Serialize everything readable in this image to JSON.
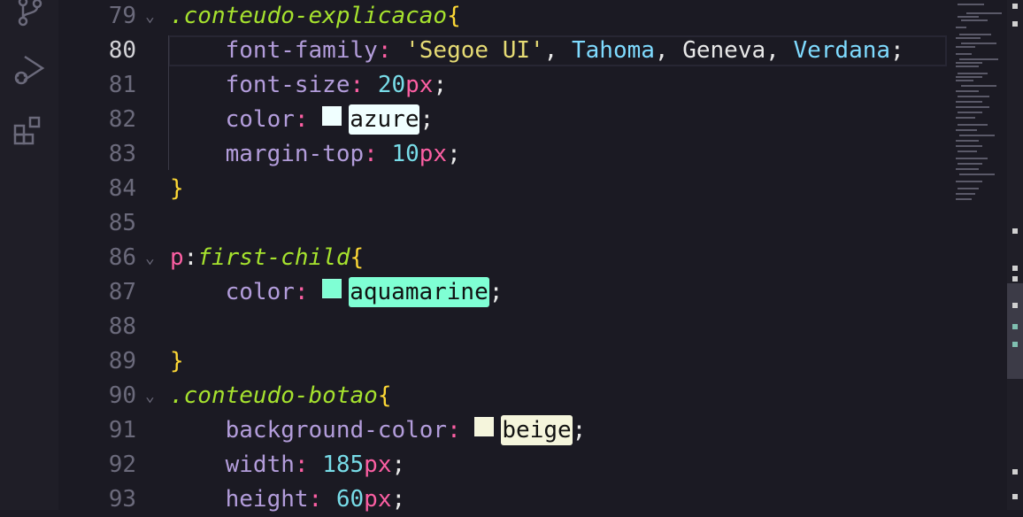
{
  "activity_bar": {
    "icons": [
      "source-control-icon",
      "run-debug-icon",
      "extensions-icon"
    ]
  },
  "editor": {
    "lines": [
      {
        "num": "79",
        "fold": "⌄",
        "tokens": [
          {
            "t": ".conteudo-explicacao",
            "c": "sel"
          },
          {
            "t": "{",
            "c": "brace"
          }
        ]
      },
      {
        "num": "80",
        "active": true,
        "tokens": [
          {
            "t": "    font-family",
            "c": "prop"
          },
          {
            "t": ": ",
            "c": "punc"
          },
          {
            "t": "'Segoe UI'",
            "c": "str"
          },
          {
            "t": ", ",
            "c": "plain"
          },
          {
            "t": "Tahoma",
            "c": "font"
          },
          {
            "t": ", ",
            "c": "plain"
          },
          {
            "t": "Geneva",
            "c": "plain"
          },
          {
            "t": ", ",
            "c": "plain"
          },
          {
            "t": "Verdana",
            "c": "font"
          },
          {
            "t": ";",
            "c": "plain"
          }
        ]
      },
      {
        "num": "81",
        "tokens": [
          {
            "t": "    font-size",
            "c": "prop"
          },
          {
            "t": ": ",
            "c": "punc"
          },
          {
            "t": "20",
            "c": "num"
          },
          {
            "t": "px",
            "c": "unit"
          },
          {
            "t": ";",
            "c": "plain"
          }
        ]
      },
      {
        "num": "82",
        "tokens": [
          {
            "t": "    color",
            "c": "prop"
          },
          {
            "t": ": ",
            "c": "punc"
          },
          {
            "swatch": "#f0ffff",
            "word": "azure"
          },
          {
            "t": ";",
            "c": "plain"
          }
        ]
      },
      {
        "num": "83",
        "tokens": [
          {
            "t": "    margin-top",
            "c": "prop"
          },
          {
            "t": ": ",
            "c": "punc"
          },
          {
            "t": "10",
            "c": "num"
          },
          {
            "t": "px",
            "c": "unit"
          },
          {
            "t": ";",
            "c": "plain"
          }
        ]
      },
      {
        "num": "84",
        "tokens": [
          {
            "t": "}",
            "c": "brace"
          }
        ]
      },
      {
        "num": "85",
        "tokens": []
      },
      {
        "num": "86",
        "fold": "⌄",
        "tokens": [
          {
            "t": "p",
            "c": "tag"
          },
          {
            "t": ":",
            "c": "plain"
          },
          {
            "t": "first-child",
            "c": "pseudo"
          },
          {
            "t": "{",
            "c": "brace"
          }
        ]
      },
      {
        "num": "87",
        "tokens": [
          {
            "t": "    color",
            "c": "prop"
          },
          {
            "t": ": ",
            "c": "punc"
          },
          {
            "swatch": "#7fffd4",
            "word": "aquamarine"
          },
          {
            "t": ";",
            "c": "plain"
          }
        ]
      },
      {
        "num": "88",
        "tokens": []
      },
      {
        "num": "89",
        "tokens": [
          {
            "t": "}",
            "c": "brace"
          }
        ]
      },
      {
        "num": "90",
        "fold": "⌄",
        "tokens": [
          {
            "t": ".conteudo-botao",
            "c": "sel"
          },
          {
            "t": "{",
            "c": "brace"
          }
        ]
      },
      {
        "num": "91",
        "tokens": [
          {
            "t": "    background-color",
            "c": "prop"
          },
          {
            "t": ": ",
            "c": "punc"
          },
          {
            "swatch": "#f5f5dc",
            "word": "beige"
          },
          {
            "t": ";",
            "c": "plain"
          }
        ]
      },
      {
        "num": "92",
        "tokens": [
          {
            "t": "    width",
            "c": "prop"
          },
          {
            "t": ": ",
            "c": "punc"
          },
          {
            "t": "185",
            "c": "num"
          },
          {
            "t": "px",
            "c": "unit"
          },
          {
            "t": ";",
            "c": "plain"
          }
        ]
      },
      {
        "num": "93",
        "tokens": [
          {
            "t": "    height",
            "c": "prop"
          },
          {
            "t": ": ",
            "c": "punc"
          },
          {
            "t": "60",
            "c": "num"
          },
          {
            "t": "px",
            "c": "unit"
          },
          {
            "t": ";",
            "c": "plain"
          }
        ]
      }
    ]
  }
}
